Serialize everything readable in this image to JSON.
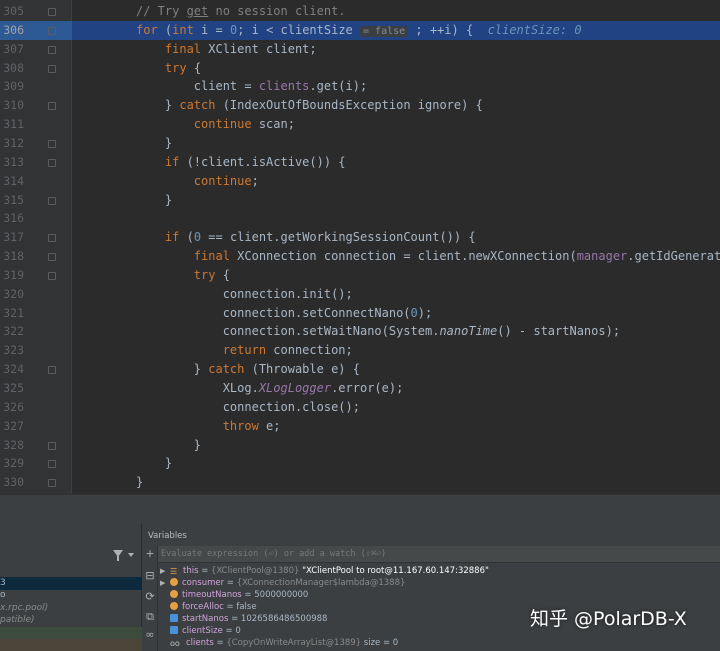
{
  "editor": {
    "current_line": "306",
    "lines": [
      {
        "num": "305",
        "parts": [
          {
            "t": "// Try ",
            "c": "cmt"
          },
          {
            "t": "get",
            "c": "cmt underline"
          },
          {
            "t": " no session client.",
            "c": "cmt"
          }
        ]
      },
      {
        "num": "306",
        "parts": [
          {
            "t": "for",
            "c": "kw"
          },
          {
            "t": " ("
          },
          {
            "t": "int",
            "c": "kw"
          },
          {
            "t": " i = "
          },
          {
            "t": "0",
            "c": "num"
          },
          {
            "t": "; i < clientSize "
          },
          {
            "t": "= false",
            "c": "hint"
          },
          {
            "t": " ; ++i) {  "
          },
          {
            "t": "clientSize: 0",
            "c": "inline-val"
          }
        ]
      },
      {
        "num": "307",
        "parts": [
          {
            "t": "    "
          },
          {
            "t": "final",
            "c": "kw"
          },
          {
            "t": " XClient client;"
          }
        ]
      },
      {
        "num": "308",
        "parts": [
          {
            "t": "    "
          },
          {
            "t": "try",
            "c": "kw"
          },
          {
            "t": " {"
          }
        ]
      },
      {
        "num": "309",
        "parts": [
          {
            "t": "        client = "
          },
          {
            "t": "clients",
            "c": "field"
          },
          {
            "t": ".get(i);"
          }
        ]
      },
      {
        "num": "310",
        "parts": [
          {
            "t": "    } "
          },
          {
            "t": "catch",
            "c": "kw"
          },
          {
            "t": " (IndexOutOfBoundsException ignore) {"
          }
        ]
      },
      {
        "num": "311",
        "parts": [
          {
            "t": "        "
          },
          {
            "t": "continue",
            "c": "kw"
          },
          {
            "t": " scan;"
          }
        ]
      },
      {
        "num": "312",
        "parts": [
          {
            "t": "    }"
          }
        ]
      },
      {
        "num": "313",
        "parts": [
          {
            "t": "    "
          },
          {
            "t": "if",
            "c": "kw"
          },
          {
            "t": " (!client.isActive()) {"
          }
        ]
      },
      {
        "num": "314",
        "parts": [
          {
            "t": "        "
          },
          {
            "t": "continue",
            "c": "kw"
          },
          {
            "t": ";"
          }
        ]
      },
      {
        "num": "315",
        "parts": [
          {
            "t": "    }"
          }
        ]
      },
      {
        "num": "316",
        "parts": []
      },
      {
        "num": "317",
        "parts": [
          {
            "t": "    "
          },
          {
            "t": "if",
            "c": "kw"
          },
          {
            "t": " ("
          },
          {
            "t": "0",
            "c": "num"
          },
          {
            "t": " == client.getWorkingSessionCount()) {"
          }
        ]
      },
      {
        "num": "318",
        "parts": [
          {
            "t": "        "
          },
          {
            "t": "final",
            "c": "kw"
          },
          {
            "t": " XConnection connection = client.newXConnection("
          },
          {
            "t": "manager",
            "c": "field"
          },
          {
            "t": ".getIdGenerator());"
          }
        ]
      },
      {
        "num": "319",
        "parts": [
          {
            "t": "        "
          },
          {
            "t": "try",
            "c": "kw"
          },
          {
            "t": " {"
          }
        ]
      },
      {
        "num": "320",
        "parts": [
          {
            "t": "            connection.init();"
          }
        ]
      },
      {
        "num": "321",
        "parts": [
          {
            "t": "            connection.setConnectNano("
          },
          {
            "t": "0",
            "c": "num"
          },
          {
            "t": ");"
          }
        ]
      },
      {
        "num": "322",
        "parts": [
          {
            "t": "            connection.setWaitNano(System."
          },
          {
            "t": "nanoTime",
            "c": "ital"
          },
          {
            "t": "() - startNanos);"
          }
        ]
      },
      {
        "num": "323",
        "parts": [
          {
            "t": "            "
          },
          {
            "t": "return",
            "c": "kw"
          },
          {
            "t": " connection;"
          }
        ]
      },
      {
        "num": "324",
        "parts": [
          {
            "t": "        } "
          },
          {
            "t": "catch",
            "c": "kw"
          },
          {
            "t": " (Throwable e) {"
          }
        ]
      },
      {
        "num": "325",
        "parts": [
          {
            "t": "            XLog."
          },
          {
            "t": "XLogLogger",
            "c": "field ital"
          },
          {
            "t": ".error(e);"
          }
        ]
      },
      {
        "num": "326",
        "parts": [
          {
            "t": "            connection.close();"
          }
        ]
      },
      {
        "num": "327",
        "parts": [
          {
            "t": "            "
          },
          {
            "t": "throw",
            "c": "kw"
          },
          {
            "t": " e;"
          }
        ]
      },
      {
        "num": "328",
        "parts": [
          {
            "t": "        }"
          }
        ]
      },
      {
        "num": "329",
        "parts": [
          {
            "t": "    }"
          }
        ]
      },
      {
        "num": "330",
        "parts": [
          {
            "t": "}"
          }
        ]
      }
    ]
  },
  "debugger": {
    "variables_title": "Variables",
    "watch_placeholder": "Evaluate expression (⏎) or add a watch (⇧⌘⏎)",
    "frames": [
      {
        "text": "",
        "style": ""
      },
      {
        "text": "3",
        "style": "sel"
      },
      {
        "text": "o",
        "style": ""
      },
      {
        "text": "x.rpc.pool)",
        "style": "ital"
      },
      {
        "text": "patible)",
        "style": "ital"
      },
      {
        "text": "",
        "style": "greenish"
      },
      {
        "text": "",
        "style": "brownish"
      },
      {
        "text": "",
        "style": "brownish"
      }
    ],
    "variables": [
      {
        "arrow": "▶",
        "icon": "list",
        "name": "this",
        "sep": " = ",
        "type": "{XClientPool@1380}",
        "value": " \"XClientPool to root@11.167.60.147:32886\"",
        "value_class": "var-str"
      },
      {
        "arrow": "▶",
        "icon": "obj",
        "name": "consumer",
        "sep": " = ",
        "type": "{XConnectionManager$lambda@1388}",
        "value": "",
        "value_class": ""
      },
      {
        "arrow": "",
        "icon": "obj",
        "name": "timeoutNanos",
        "sep": " = ",
        "type": "",
        "value": "5000000000",
        "value_class": ""
      },
      {
        "arrow": "",
        "icon": "obj",
        "name": "forceAlloc",
        "sep": " = ",
        "type": "",
        "value": "false",
        "value_class": ""
      },
      {
        "arrow": "",
        "icon": "prim",
        "name": "startNanos",
        "sep": " = ",
        "type": "",
        "value": "1026586486500988",
        "value_class": ""
      },
      {
        "arrow": "",
        "icon": "prim",
        "name": "clientSize",
        "sep": " = ",
        "type": "",
        "value": "0",
        "value_class": ""
      },
      {
        "arrow": "",
        "icon": "watch",
        "name": "clients",
        "sep": " = ",
        "type": "{CopyOnWriteArrayList@1389}",
        "value": "  size = 0",
        "value_class": ""
      }
    ]
  },
  "watermark": "知乎 @PolarDB-X",
  "colors": {
    "keyword": "#cc7832",
    "number": "#6897bb",
    "field": "#9876aa",
    "comment": "#808080",
    "current_line": "#214283"
  }
}
